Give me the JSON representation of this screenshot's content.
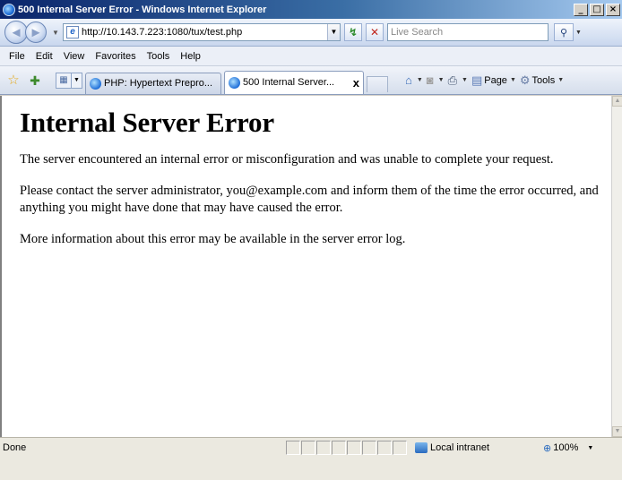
{
  "window": {
    "title": "500 Internal Server Error - Windows Internet Explorer",
    "controls": {
      "minimize": "_",
      "maximize": "□",
      "close": "×"
    }
  },
  "address_bar": {
    "url": "http://10.143.7.223:1080/tux/test.php",
    "search_placeholder": "Live Search"
  },
  "menu": {
    "items": [
      {
        "label": "File",
        "accel": "F"
      },
      {
        "label": "Edit",
        "accel": "E"
      },
      {
        "label": "View",
        "accel": "V"
      },
      {
        "label": "Favorites",
        "accel": "a"
      },
      {
        "label": "Tools",
        "accel": "T"
      },
      {
        "label": "Help",
        "accel": "H"
      }
    ]
  },
  "tabs": [
    {
      "label": "PHP: Hypertext Prepro...",
      "active": false
    },
    {
      "label": "500 Internal Server...",
      "active": true,
      "close": "x"
    }
  ],
  "command_bar": {
    "page_label": "Page",
    "tools_label": "Tools"
  },
  "icons": {
    "favorites": "star-icon",
    "add_favorites": "add-favorites-icon",
    "home": "home-icon",
    "feeds": "feeds-icon",
    "print": "print-icon",
    "page": "page-icon",
    "tools": "gear-icon",
    "search": "search-icon",
    "refresh": "refresh-icon",
    "stop": "stop-icon"
  },
  "content": {
    "heading": "Internal Server Error",
    "paragraphs": [
      "The server encountered an internal error or misconfiguration and was unable to complete your request.",
      "Please contact the server administrator, you@example.com and inform them of the time the error occurred, and anything you might have done that may have caused the error.",
      "More information about this error may be available in the server error log."
    ]
  },
  "status": {
    "text": "Done",
    "zone": "Local intranet",
    "zoom": "100%"
  }
}
